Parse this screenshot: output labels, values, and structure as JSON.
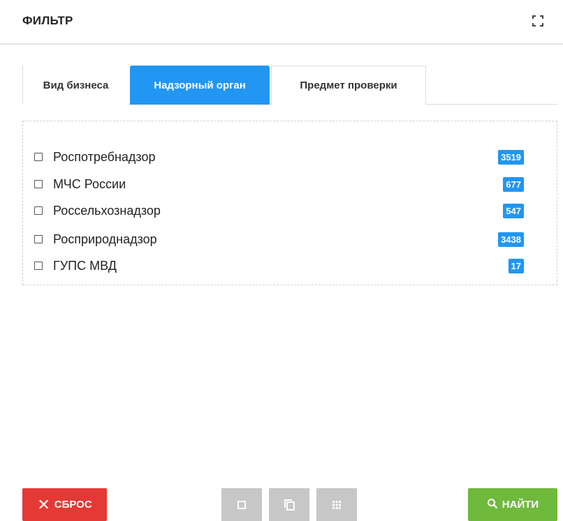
{
  "header": {
    "title": "ФИЛЬТР",
    "expand_icon": "expand-icon"
  },
  "tabs": [
    {
      "label": "Вид бизнеса",
      "active": false
    },
    {
      "label": "Надзорный орган",
      "active": true
    },
    {
      "label": "Предмет проверки",
      "active": false
    }
  ],
  "items": [
    {
      "label": "Роспотребнадзор",
      "count": "3519",
      "checked": false
    },
    {
      "label": "МЧС России",
      "count": "677",
      "checked": false
    },
    {
      "label": "Россельхознадзор",
      "count": "547",
      "checked": false
    },
    {
      "label": "Росприроднадзор",
      "count": "3438",
      "checked": false
    },
    {
      "label": "ГУПС МВД",
      "count": "17",
      "checked": false
    }
  ],
  "footer": {
    "reset_label": "СБРОС",
    "find_label": "НАЙТИ",
    "view_buttons": [
      "single-view-icon",
      "stacked-view-icon",
      "grid-view-icon"
    ]
  },
  "colors": {
    "accent": "#2196f3",
    "reset": "#e53935",
    "find": "#6fb93c",
    "view_button": "#c7c7c7"
  }
}
